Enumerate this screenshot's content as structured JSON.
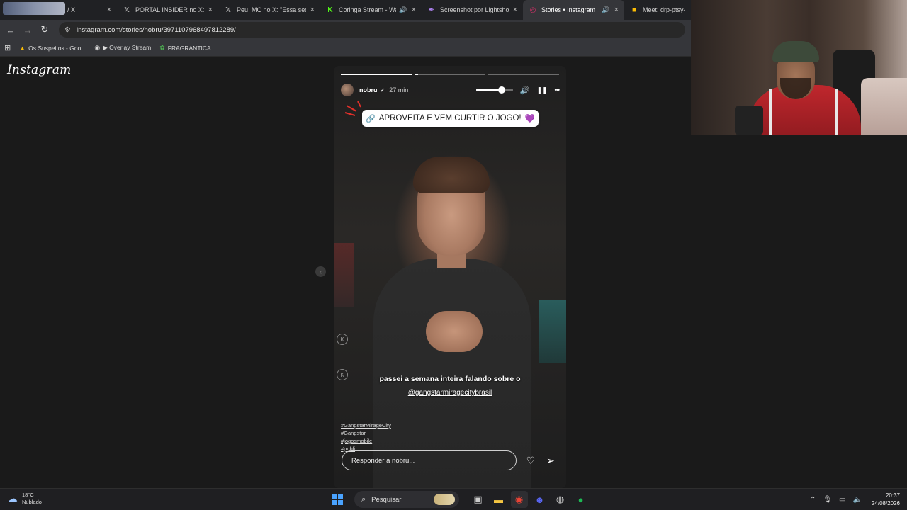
{
  "tabs": [
    {
      "title": "/ X",
      "icon": "blurred-thumbnail",
      "close": "×"
    },
    {
      "title": "PORTAL INSIDER no X: \"",
      "icon": "x-logo-icon",
      "close": "×"
    },
    {
      "title": "Peu_MC no X: \"Essa sequê",
      "icon": "x-logo-icon",
      "close": "×"
    },
    {
      "title": "Coringa Stream - Watc",
      "icon": "kick-icon",
      "close": "×",
      "audio": "🔊"
    },
    {
      "title": "Screenshot por Lightshot",
      "icon": "lightshot-icon",
      "close": "×"
    },
    {
      "title": "Stories • Instagram",
      "icon": "instagram-icon",
      "close": "×",
      "audio": "🔊",
      "active": true
    },
    {
      "title": "Meet: drp-ptsy-ewi",
      "icon": "meet-icon"
    }
  ],
  "toolbar": {
    "back": "←",
    "forward": "→",
    "reload": "↻",
    "url": "instagram.com/stories/nobru/3971107968497812289/"
  },
  "bookmarks": [
    {
      "label": "Os Suspeitos - Goo...",
      "icon": "drive-icon"
    },
    {
      "label": "▶ Overlay Stream",
      "icon": "globe-icon"
    },
    {
      "label": "FRAGRANTICA",
      "icon": "fragrantica-icon"
    }
  ],
  "instagram": {
    "logo": "Instagram",
    "prev_arrow": "‹"
  },
  "story": {
    "progress": [
      1.0,
      0.05,
      0.0
    ],
    "username": "nobru",
    "verified_glyph": "✔",
    "time": "27 min",
    "volume": 0.7,
    "pause_glyph": "❚❚",
    "more_glyph": "•••",
    "volume_glyph": "🔊",
    "link_sticker": "APROVEITA E VEM CURTIR O JOGO!",
    "link_glyph": "🔗",
    "heart_glyph": "💜",
    "caption": "passei a semana inteira falando sobre o",
    "mention": "@gangstarmiragecitybrasil",
    "hashtags": [
      "#GangstarMirageCity",
      "#Gangstar",
      "#jogosmobile",
      "#publi"
    ],
    "reply_placeholder": "Responder a nobru...",
    "like_glyph": "♡",
    "share_glyph": "➢"
  },
  "taskbar": {
    "temperature": "18°C",
    "condition": "Nublado",
    "search_label": "Pesquisar",
    "time": "20:37",
    "date": "24/08/2026"
  },
  "colors": {
    "chrome_bg": "#202124",
    "toolbar_bg": "#35363a",
    "page_bg": "#1a1a1a",
    "sticker_heart": "#8b3fd9",
    "windows_blue": "#4aa3ff"
  }
}
